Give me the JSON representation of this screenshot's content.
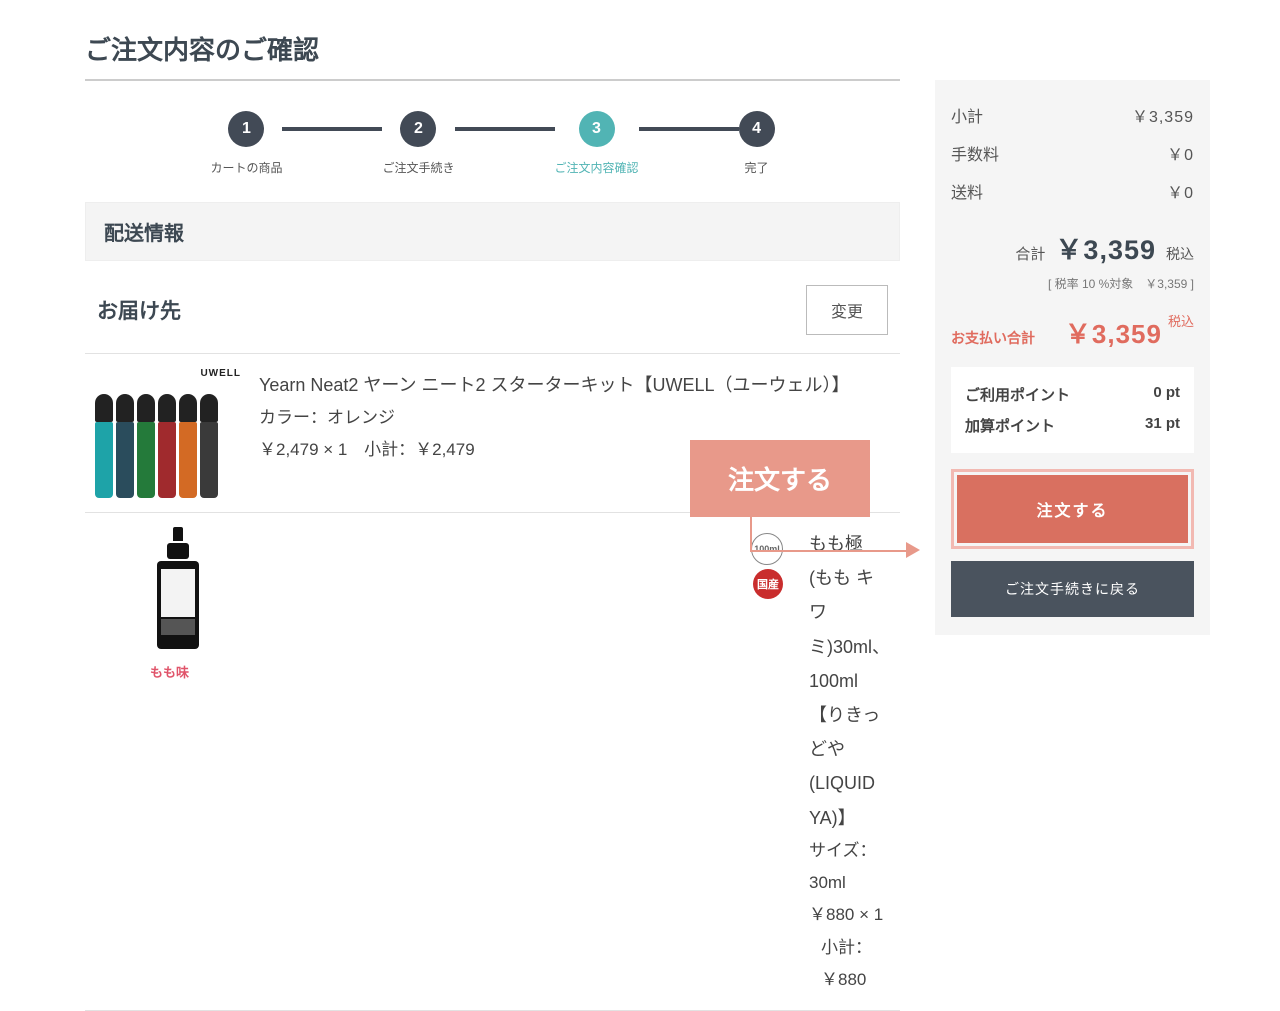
{
  "page": {
    "title": "ご注文内容のご確認"
  },
  "steps": {
    "s1": "カートの商品",
    "s2": "ご注文手続き",
    "s3": "ご注文内容確認",
    "s4": "完了"
  },
  "delivery": {
    "section_title": "配送情報",
    "address_label": "お届け先",
    "change_button": "変更"
  },
  "items": {
    "i0": {
      "brand": "UWELL",
      "title": "Yearn Neat2 ヤーン ニート2 スターターキット【UWELL（ユーウェル）】",
      "option": "カラー：オレンジ",
      "price_line": "￥2,479 × 1",
      "subtotal_line": "小計：￥2,479"
    },
    "i1": {
      "title": "もも極 (もも キワミ)30ml、100ml 【りきっどや(LIQUID YA)】",
      "option": "サイズ：30ml",
      "price_line": "￥880 × 1",
      "subtotal_line": "小計：￥880",
      "flavor_label": "もも味",
      "badge_size": "100ml",
      "badge_domestic": "国産"
    }
  },
  "summary": {
    "subtotal_label": "小計",
    "subtotal_value": "￥3,359",
    "fee_label": "手数料",
    "fee_value": "￥0",
    "shipping_label": "送料",
    "shipping_value": "￥0",
    "total_label": "合計",
    "total_value": "￥3,359",
    "tax_inc": "税込",
    "tax_note": "[ 税率 10 %対象　￥3,359 ]",
    "pay_label": "お支払い合計",
    "pay_value": "￥3,359",
    "tax_inc2": "税込",
    "points_used_label": "ご利用ポイント",
    "points_used_value": "0 pt",
    "points_add_label": "加算ポイント",
    "points_add_value": "31 pt",
    "order_button": "注文する",
    "back_button": "ご注文手続きに戻る"
  },
  "callout": {
    "label": "注文する"
  },
  "colors": {
    "vapes": [
      "#1ea3a8",
      "#2a4c5c",
      "#247a3a",
      "#a02a2d",
      "#d36a24",
      "#3a3a3a"
    ]
  }
}
